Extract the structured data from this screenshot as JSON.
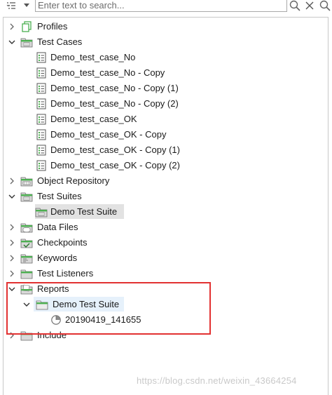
{
  "search": {
    "placeholder": "Enter text to search..."
  },
  "tree": {
    "profiles": "Profiles",
    "test_cases": "Test Cases",
    "test_case_items": [
      "Demo_test_case_No",
      "Demo_test_case_No - Copy",
      "Demo_test_case_No - Copy (1)",
      "Demo_test_case_No - Copy (2)",
      "Demo_test_case_OK",
      "Demo_test_case_OK - Copy",
      "Demo_test_case_OK - Copy (1)",
      "Demo_test_case_OK - Copy (2)"
    ],
    "object_repository": "Object Repository",
    "test_suites": "Test Suites",
    "demo_test_suite": "Demo Test Suite",
    "data_files": "Data Files",
    "checkpoints": "Checkpoints",
    "keywords": "Keywords",
    "test_listeners": "Test Listeners",
    "reports": "Reports",
    "report_suite": "Demo Test Suite",
    "report_run": "20190419_141655",
    "include": "Include"
  },
  "watermark": "https://blog.csdn.net/weixin_43664254",
  "colors": {
    "highlight": "#e23131",
    "folder": "#4caf50",
    "selection": "#e2e2e2"
  }
}
